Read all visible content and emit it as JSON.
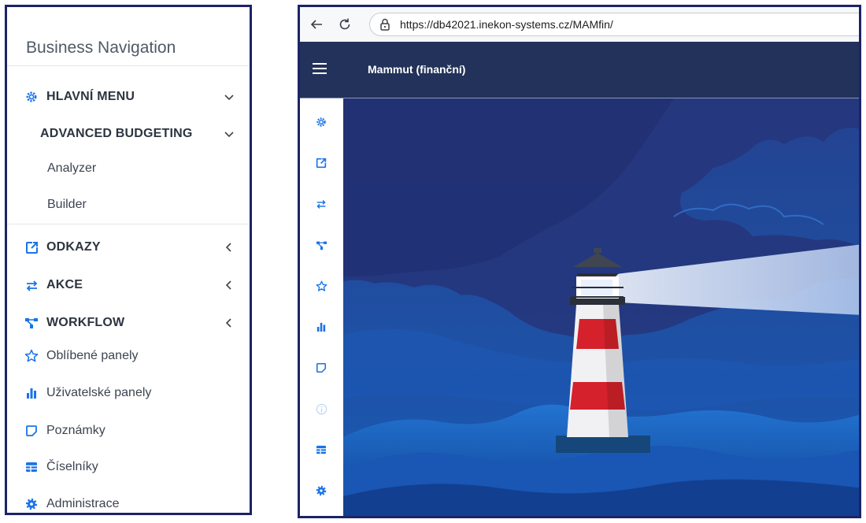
{
  "left_panel": {
    "title": "Business Navigation",
    "items": [
      {
        "label": "HLAVNÍ MENU",
        "icon": "gear-icon",
        "chevron": "down"
      },
      {
        "label": "ADVANCED BUDGETING",
        "chevron": "down"
      },
      {
        "label": "Analyzer"
      },
      {
        "label": "Builder"
      },
      {
        "label": "ODKAZY",
        "icon": "external-link-icon",
        "chevron": "left"
      },
      {
        "label": "AKCE",
        "icon": "swap-arrows-icon",
        "chevron": "left"
      },
      {
        "label": "WORKFLOW",
        "icon": "workflow-icon",
        "chevron": "left"
      },
      {
        "label": "Oblíbené panely",
        "icon": "star-icon"
      },
      {
        "label": "Uživatelské panely",
        "icon": "bar-chart-icon"
      },
      {
        "label": "Poznámky",
        "icon": "note-icon"
      },
      {
        "label": "Číselníky",
        "icon": "table-icon"
      },
      {
        "label": "Administrace",
        "icon": "cog-icon"
      }
    ]
  },
  "browser": {
    "url": "https://db42021.inekon-systems.cz/MAMfin/"
  },
  "app": {
    "title": "Mammut (finanční)"
  },
  "colors": {
    "accent_blue": "#1a73e8",
    "topbar": "#22325a",
    "frame_border": "#1c2466",
    "text_dark": "#2c3440"
  }
}
